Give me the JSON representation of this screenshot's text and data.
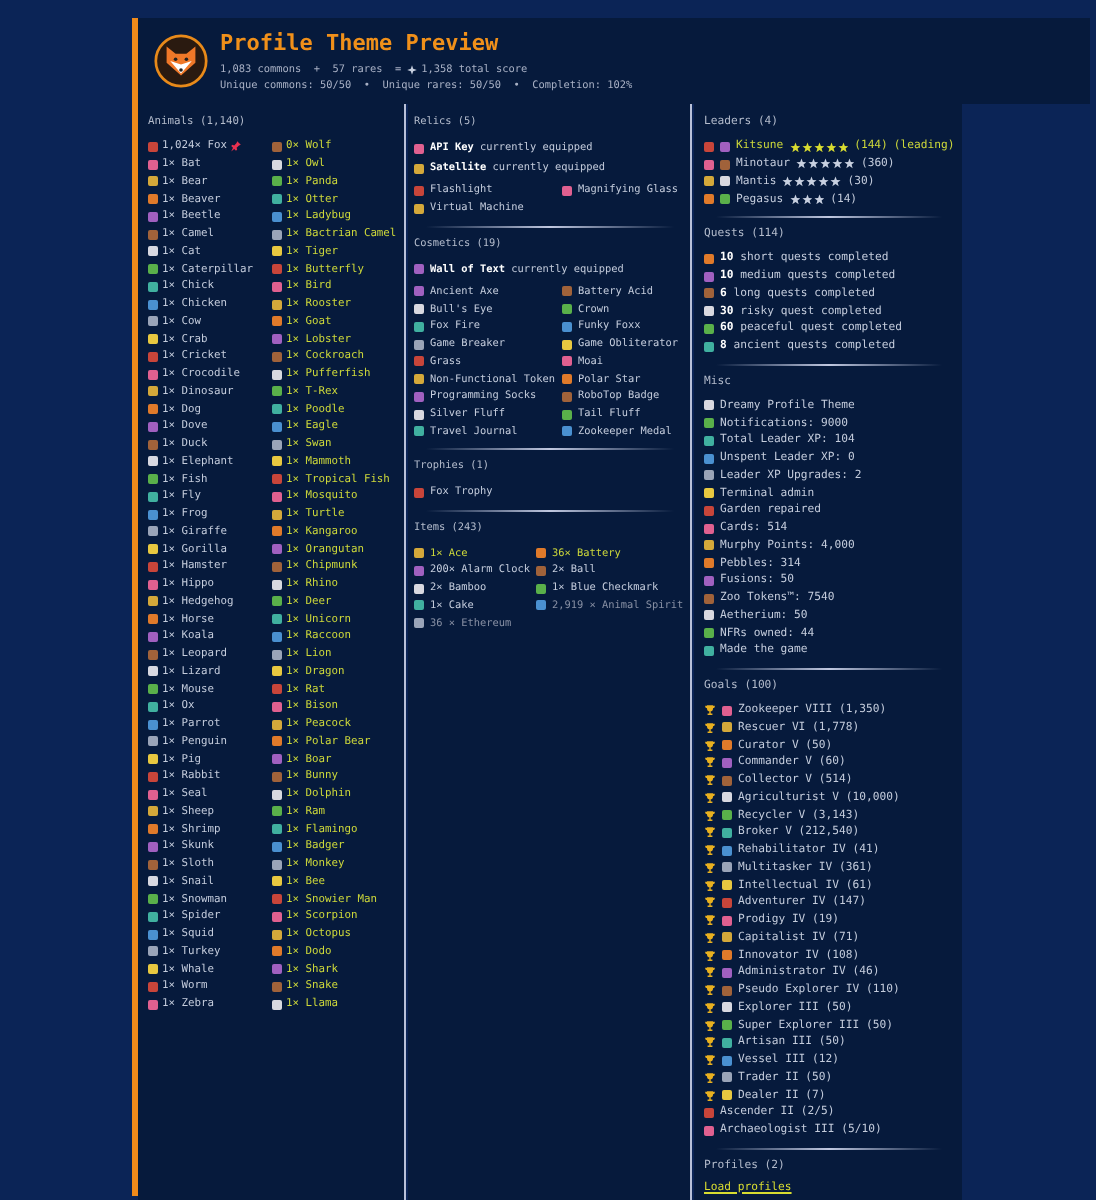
{
  "header": {
    "title": "Profile Theme Preview",
    "score_before": "1,083 commons  +  57 rares  =",
    "score_after": "1,358 total score",
    "uniques": "Unique commons: 50/50  •  Unique rares: 50/50  •  Completion: 102%"
  },
  "animals": {
    "title": "Animals (1,140)",
    "common": [
      {
        "label": "1,024× Fox",
        "pinned": true
      },
      {
        "label": "1× Bat",
        "pinned": false
      },
      {
        "label": "1× Bear",
        "pinned": false
      },
      {
        "label": "1× Beaver",
        "pinned": false
      },
      {
        "label": "1× Beetle",
        "pinned": false
      },
      {
        "label": "1× Camel",
        "pinned": false
      },
      {
        "label": "1× Cat",
        "pinned": false
      },
      {
        "label": "1× Caterpillar",
        "pinned": false
      },
      {
        "label": "1× Chick",
        "pinned": false
      },
      {
        "label": "1× Chicken",
        "pinned": false
      },
      {
        "label": "1× Cow",
        "pinned": false
      },
      {
        "label": "1× Crab",
        "pinned": false
      },
      {
        "label": "1× Cricket",
        "pinned": false
      },
      {
        "label": "1× Crocodile",
        "pinned": false
      },
      {
        "label": "1× Dinosaur",
        "pinned": false
      },
      {
        "label": "1× Dog",
        "pinned": false
      },
      {
        "label": "1× Dove",
        "pinned": false
      },
      {
        "label": "1× Duck",
        "pinned": false
      },
      {
        "label": "1× Elephant",
        "pinned": false
      },
      {
        "label": "1× Fish",
        "pinned": false
      },
      {
        "label": "1× Fly",
        "pinned": false
      },
      {
        "label": "1× Frog",
        "pinned": false
      },
      {
        "label": "1× Giraffe",
        "pinned": false
      },
      {
        "label": "1× Gorilla",
        "pinned": false
      },
      {
        "label": "1× Hamster",
        "pinned": false
      },
      {
        "label": "1× Hippo",
        "pinned": false
      },
      {
        "label": "1× Hedgehog",
        "pinned": false
      },
      {
        "label": "1× Horse",
        "pinned": false
      },
      {
        "label": "1× Koala",
        "pinned": false
      },
      {
        "label": "1× Leopard",
        "pinned": false
      },
      {
        "label": "1× Lizard",
        "pinned": false
      },
      {
        "label": "1× Mouse",
        "pinned": false
      },
      {
        "label": "1× Ox",
        "pinned": false
      },
      {
        "label": "1× Parrot",
        "pinned": false
      },
      {
        "label": "1× Penguin",
        "pinned": false
      },
      {
        "label": "1× Pig",
        "pinned": false
      },
      {
        "label": "1× Rabbit",
        "pinned": false
      },
      {
        "label": "1× Seal",
        "pinned": false
      },
      {
        "label": "1× Sheep",
        "pinned": false
      },
      {
        "label": "1× Shrimp",
        "pinned": false
      },
      {
        "label": "1× Skunk",
        "pinned": false
      },
      {
        "label": "1× Sloth",
        "pinned": false
      },
      {
        "label": "1× Snail",
        "pinned": false
      },
      {
        "label": "1× Snowman",
        "pinned": false
      },
      {
        "label": "1× Spider",
        "pinned": false
      },
      {
        "label": "1× Squid",
        "pinned": false
      },
      {
        "label": "1× Turkey",
        "pinned": false
      },
      {
        "label": "1× Whale",
        "pinned": false
      },
      {
        "label": "1× Worm",
        "pinned": false
      },
      {
        "label": "1× Zebra",
        "pinned": false
      }
    ],
    "rare": [
      {
        "label": "0× Wolf"
      },
      {
        "label": "1× Owl"
      },
      {
        "label": "1× Panda"
      },
      {
        "label": "1× Otter"
      },
      {
        "label": "1× Ladybug"
      },
      {
        "label": "1× Bactrian Camel"
      },
      {
        "label": "1× Tiger"
      },
      {
        "label": "1× Butterfly"
      },
      {
        "label": "1× Bird"
      },
      {
        "label": "1× Rooster"
      },
      {
        "label": "1× Goat"
      },
      {
        "label": "1× Lobster"
      },
      {
        "label": "1× Cockroach"
      },
      {
        "label": "1× Pufferfish"
      },
      {
        "label": "1× T-Rex"
      },
      {
        "label": "1× Poodle"
      },
      {
        "label": "1× Eagle"
      },
      {
        "label": "1× Swan"
      },
      {
        "label": "1× Mammoth"
      },
      {
        "label": "1× Tropical Fish"
      },
      {
        "label": "1× Mosquito"
      },
      {
        "label": "1× Turtle"
      },
      {
        "label": "1× Kangaroo"
      },
      {
        "label": "1× Orangutan"
      },
      {
        "label": "1× Chipmunk"
      },
      {
        "label": "1× Rhino"
      },
      {
        "label": "1× Deer"
      },
      {
        "label": "1× Unicorn"
      },
      {
        "label": "1× Raccoon"
      },
      {
        "label": "1× Lion"
      },
      {
        "label": "1× Dragon"
      },
      {
        "label": "1× Rat"
      },
      {
        "label": "1× Bison"
      },
      {
        "label": "1× Peacock"
      },
      {
        "label": "1× Polar Bear"
      },
      {
        "label": "1× Boar"
      },
      {
        "label": "1× Bunny"
      },
      {
        "label": "1× Dolphin"
      },
      {
        "label": "1× Ram"
      },
      {
        "label": "1× Flamingo"
      },
      {
        "label": "1× Badger"
      },
      {
        "label": "1× Monkey"
      },
      {
        "label": "1× Bee"
      },
      {
        "label": "1× Snowier Man"
      },
      {
        "label": "1× Scorpion"
      },
      {
        "label": "1× Octopus"
      },
      {
        "label": "1× Dodo"
      },
      {
        "label": "1× Shark"
      },
      {
        "label": "1× Snake"
      },
      {
        "label": "1× Llama"
      }
    ]
  },
  "relics": {
    "title": "Relics (5)",
    "equipped": [
      "**API Key** currently equipped",
      "**Satellite** currently equipped"
    ],
    "items": [
      "Flashlight",
      "Magnifying Glass",
      "Virtual Machine"
    ]
  },
  "cosmetics": {
    "title": "Cosmetics (19)",
    "equipped": [
      "**Wall of Text** currently equipped"
    ],
    "items": [
      "Ancient Axe",
      "Battery Acid",
      "Bull's Eye",
      "Crown",
      "Fox Fire",
      "Funky Foxx",
      "Game Breaker",
      "Game Obliterator",
      "Grass",
      "Moai",
      "Non-Functional Token",
      "Polar Star",
      "Programming Socks",
      "RoboTop Badge",
      "Silver Fluff",
      "Tail Fluff",
      "Travel Journal",
      "Zookeeper Medal"
    ]
  },
  "trophies": {
    "title": "Trophies (1)",
    "items": [
      "Fox Trophy"
    ]
  },
  "items": {
    "title": "Items (243)",
    "list": [
      {
        "label": "1× Ace",
        "kind": "rare"
      },
      {
        "label": "36× Battery",
        "kind": "rare"
      },
      {
        "label": "200× Alarm Clock",
        "kind": "common"
      },
      {
        "label": "2× Ball",
        "kind": "common"
      },
      {
        "label": "2× Bamboo",
        "kind": "common"
      },
      {
        "label": "1× Blue Checkmark",
        "kind": "common"
      },
      {
        "label": "1× Cake",
        "kind": "common"
      },
      {
        "label": "2,919 × Animal Spirit",
        "kind": "currency"
      },
      {
        "label": "36 × Ethereum",
        "kind": "currency"
      }
    ]
  },
  "leaders": {
    "title": "Leaders (4)",
    "list": [
      {
        "name": "Kitsune",
        "stars": 5,
        "count": "(144)",
        "note": "(leading)",
        "selected": true
      },
      {
        "name": "Minotaur",
        "stars": 5,
        "count": "(360)",
        "selected": false
      },
      {
        "name": "Mantis",
        "stars": 5,
        "count": "(30)",
        "selected": false
      },
      {
        "name": "Pegasus",
        "stars": 3,
        "count": "(14)",
        "selected": false
      }
    ]
  },
  "quests": {
    "title": "Quests (114)",
    "list": [
      "**10** short quests completed",
      "**10** medium quests completed",
      "**6** long quests completed",
      "**30** risky quest completed",
      "**60** peaceful quest completed",
      "**8** ancient quests completed"
    ]
  },
  "misc": {
    "title": "Misc",
    "list": [
      "Dreamy Profile Theme",
      "Notifications: 9000",
      "Total Leader XP: 104",
      "Unspent Leader XP: 0",
      "Leader XP Upgrades: 2",
      "Terminal admin",
      "Garden repaired",
      "Cards: 514",
      "Murphy Points: 4,000",
      "Pebbles: 314",
      "Fusions: 50",
      "Zoo Tokens™: 7540",
      "Aetherium: 50",
      "NFRs owned: 44",
      "Made the game"
    ]
  },
  "goals": {
    "title": "Goals (100)",
    "list": [
      {
        "label": "Zookeeper VIII (1,350)",
        "completed": true
      },
      {
        "label": "Rescuer VI (1,778)",
        "completed": true
      },
      {
        "label": "Curator V (50)",
        "completed": true
      },
      {
        "label": "Commander V (60)",
        "completed": true
      },
      {
        "label": "Collector V (514)",
        "completed": true
      },
      {
        "label": "Agriculturist V (10,000)",
        "completed": true
      },
      {
        "label": "Recycler V (3,143)",
        "completed": true
      },
      {
        "label": "Broker V (212,540)",
        "completed": true
      },
      {
        "label": "Rehabilitator IV (41)",
        "completed": true
      },
      {
        "label": "Multitasker IV (361)",
        "completed": true
      },
      {
        "label": "Intellectual IV (61)",
        "completed": true
      },
      {
        "label": "Adventurer IV (147)",
        "completed": true
      },
      {
        "label": "Prodigy IV (19)",
        "completed": true
      },
      {
        "label": "Capitalist IV (71)",
        "completed": true
      },
      {
        "label": "Innovator IV (108)",
        "completed": true
      },
      {
        "label": "Administrator IV (46)",
        "completed": true
      },
      {
        "label": "Pseudo Explorer IV (110)",
        "completed": true
      },
      {
        "label": "Explorer III (50)",
        "completed": true
      },
      {
        "label": "Super Explorer III (50)",
        "completed": true
      },
      {
        "label": "Artisan III (50)",
        "completed": true
      },
      {
        "label": "Vessel III (12)",
        "completed": true
      },
      {
        "label": "Trader II (50)",
        "completed": true
      },
      {
        "label": "Dealer II (7)",
        "completed": true
      },
      {
        "label": "Ascender II (2/5)",
        "completed": false
      },
      {
        "label": "Archaeologist III (5/10)",
        "completed": false
      }
    ]
  },
  "profiles": {
    "title": "Profiles (2)",
    "link": "Load profiles"
  }
}
